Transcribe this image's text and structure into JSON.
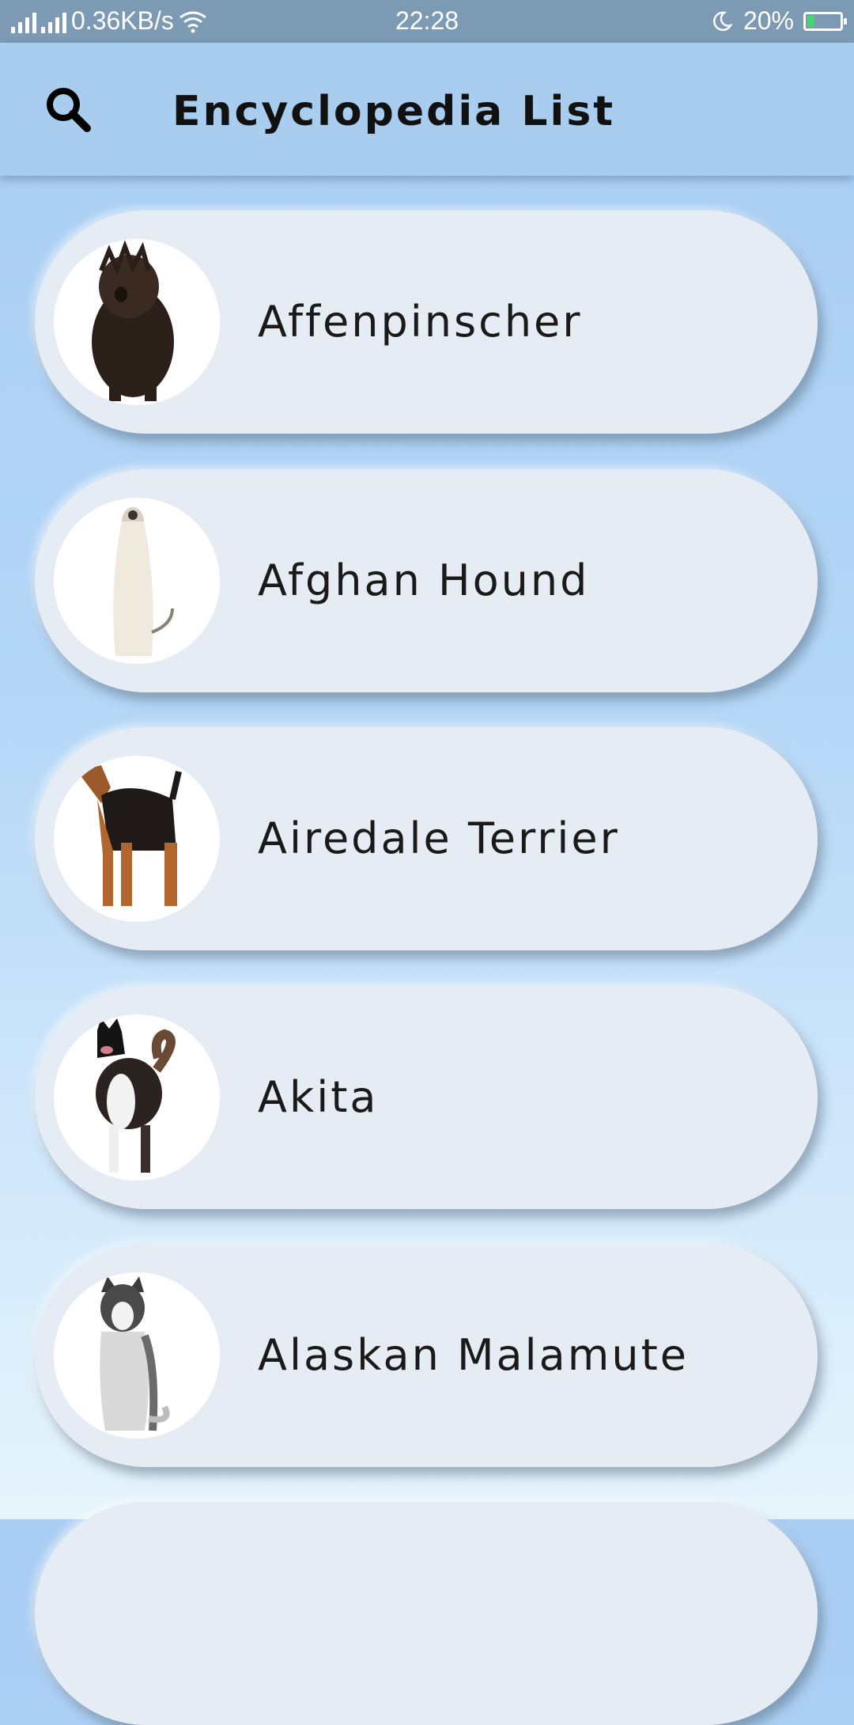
{
  "status_bar": {
    "net_speed": "0.36KB/s",
    "time": "22:28",
    "battery": "20%",
    "battery_level": 0.2
  },
  "app_bar": {
    "title": "Encyclopedia List",
    "icon": "search-icon"
  },
  "breeds": [
    {
      "name": "Affenpinscher",
      "image": "dark shaggy dog"
    },
    {
      "name": "Afghan Hound",
      "image": "long-haired cream hound"
    },
    {
      "name": "Airedale Terrier",
      "image": "tan and black terrier"
    },
    {
      "name": "Akita",
      "image": "black white and brown akita"
    },
    {
      "name": "Alaskan Malamute",
      "image": "grey and white malamute"
    }
  ]
}
